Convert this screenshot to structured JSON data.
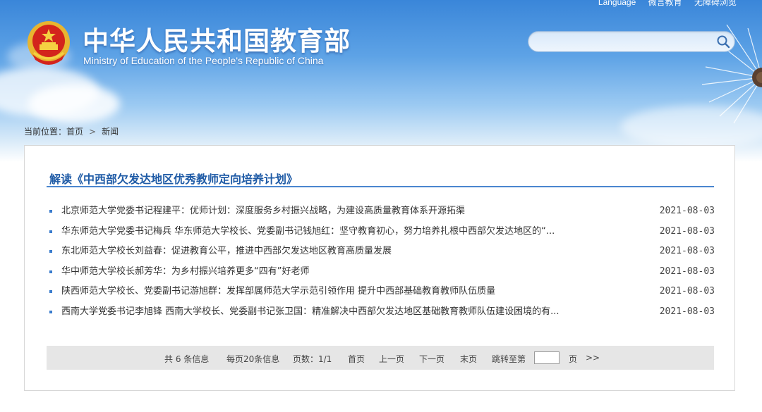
{
  "header": {
    "top_links": [
      "Language",
      "微言教育",
      "无障碍浏览"
    ],
    "title": "中华人民共和国教育部",
    "subtitle": "Ministry of Education of the People's Republic of China",
    "search": {
      "value": "",
      "placeholder": ""
    }
  },
  "breadcrumb": {
    "prefix": "当前位置：",
    "home": "首页",
    "separator": ">",
    "current": "新闻"
  },
  "section": {
    "title": "解读《中西部欠发达地区优秀教师定向培养计划》",
    "items": [
      {
        "title": "北京师范大学党委书记程建平：优师计划：深度服务乡村振兴战略，为建设高质量教育体系开源拓渠",
        "date": "2021-08-03"
      },
      {
        "title": "华东师范大学党委书记梅兵 华东师范大学校长、党委副书记钱旭红：坚守教育初心，努力培养扎根中西部欠发达地区的“...",
        "date": "2021-08-03"
      },
      {
        "title": "东北师范大学校长刘益春：促进教育公平，推进中西部欠发达地区教育高质量发展",
        "date": "2021-08-03"
      },
      {
        "title": "华中师范大学校长郝芳华：为乡村振兴培养更多“四有”好老师",
        "date": "2021-08-03"
      },
      {
        "title": "陕西师范大学校长、党委副书记游旭群：发挥部属师范大学示范引领作用 提升中西部基础教育教师队伍质量",
        "date": "2021-08-03"
      },
      {
        "title": "西南大学党委书记李旭锋 西南大学校长、党委副书记张卫国：精准解决中西部欠发达地区基础教育教师队伍建设困境的有...",
        "date": "2021-08-03"
      }
    ]
  },
  "pager": {
    "total": "共 6 条信息",
    "per_page": "每页20条信息",
    "pages": "页数：1/1",
    "first": "首页",
    "prev": "上一页",
    "next": "下一页",
    "last": "末页",
    "jump_label": "跳转至第",
    "jump_value": "",
    "page_unit": "页",
    "go": ">>"
  },
  "colors": {
    "accent": "#1f5ba6",
    "rule": "#4a86cf",
    "bullet": "#3a7ccd",
    "pager_bg": "#e6e6e6"
  }
}
